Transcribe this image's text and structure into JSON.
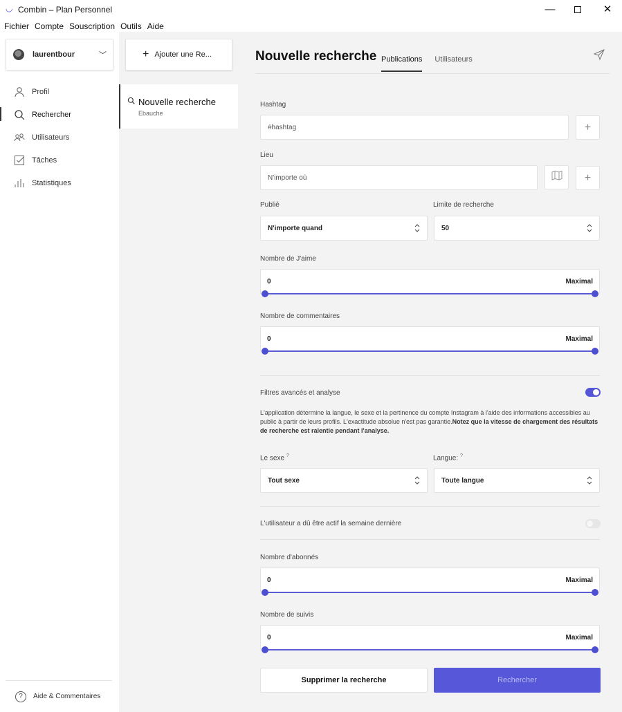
{
  "window": {
    "title": "Combin – Plan Personnel"
  },
  "menu": {
    "items": [
      "Fichier",
      "Compte",
      "Souscription",
      "Outils",
      "Aide"
    ]
  },
  "account": {
    "username": "laurentbour"
  },
  "nav": {
    "items": [
      {
        "label": "Profil",
        "icon": "person-icon"
      },
      {
        "label": "Rechercher",
        "icon": "search-icon"
      },
      {
        "label": "Utilisateurs",
        "icon": "users-icon"
      },
      {
        "label": "Tâches",
        "icon": "task-icon"
      },
      {
        "label": "Statistiques",
        "icon": "stats-icon"
      }
    ],
    "help_label": "Aide & Commentaires"
  },
  "searches": {
    "add_label": "Ajouter une Re...",
    "items": [
      {
        "title": "Nouvelle recherche",
        "subtitle": "Ebauche"
      }
    ]
  },
  "main": {
    "title": "Nouvelle recherche",
    "tabs": [
      "Publications",
      "Utilisateurs"
    ],
    "hashtag": {
      "label": "Hashtag",
      "placeholder": "#hashtag"
    },
    "lieu": {
      "label": "Lieu",
      "placeholder": "N'importe où"
    },
    "publie": {
      "label": "Publié",
      "value": "N'importe quand"
    },
    "limite": {
      "label": "Limite de recherche",
      "value": "50"
    },
    "likes": {
      "label": "Nombre de J'aime",
      "min": "0",
      "max": "Maximal"
    },
    "comments": {
      "label": "Nombre de commentaires",
      "min": "0",
      "max": "Maximal"
    },
    "advanced": {
      "label": "Filtres avancés et analyse",
      "enabled": true,
      "desc": "L'application détermine la langue, le sexe et la pertinence du compte Instagram à l'aide des informations accessibles au public à partir de leurs profils. L'exactitude absolue n'est pas garantie.",
      "desc_bold": "Notez que la vitesse de chargement des résultats de recherche est ralentie pendant l'analyse."
    },
    "sexe": {
      "label": "Le sexe",
      "value": "Tout sexe"
    },
    "langue": {
      "label": "Langue:",
      "value": "Toute langue"
    },
    "question_mark": "?",
    "active_week": {
      "label": "L'utilisateur a dû être actif la semaine dernière",
      "enabled": false
    },
    "followers": {
      "label": "Nombre d'abonnés",
      "min": "0",
      "max": "Maximal"
    },
    "following": {
      "label": "Nombre de suivis",
      "min": "0",
      "max": "Maximal"
    },
    "delete_label": "Supprimer la recherche",
    "search_label": "Rechercher"
  },
  "colors": {
    "accent": "#5658d9",
    "panel_bg": "#f3f3f3"
  }
}
